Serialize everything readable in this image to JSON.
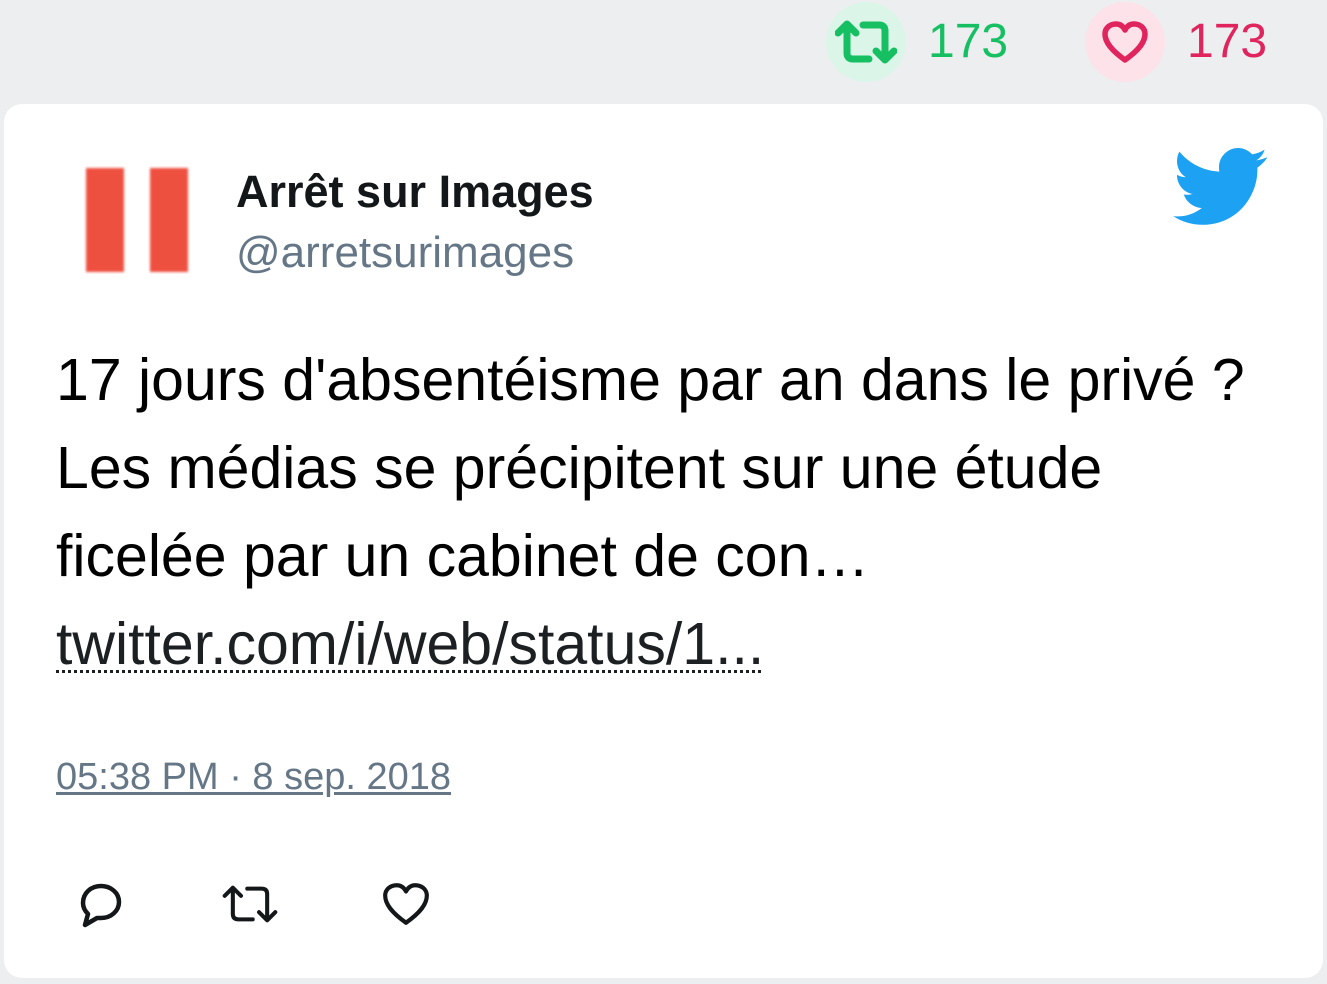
{
  "header_stats": {
    "retweets": {
      "icon": "retweet-icon",
      "count": "173",
      "color": "#17bf63"
    },
    "likes": {
      "icon": "heart-icon",
      "count": "173",
      "color": "#e0245e"
    }
  },
  "tweet": {
    "author_name": "Arrêt sur Images",
    "author_handle": "@arretsurimages",
    "avatar_icon": "pause-logo",
    "brand_icon": "twitter-bird-icon",
    "text": "17 jours d'absentéisme par an dans le privé ? Les médias se précipitent sur une étude ficelée par un cabinet de con… ",
    "link_text": "twitter.com/i/web/status/1...",
    "timestamp": "05:38 PM · 8 sep. 2018"
  },
  "actions": [
    {
      "icon": "reply-icon"
    },
    {
      "icon": "retweet-icon"
    },
    {
      "icon": "heart-icon"
    }
  ],
  "colors": {
    "background": "#eceef0",
    "card": "#ffffff",
    "twitter_blue": "#1da1f2",
    "muted": "#657786",
    "logo_red": "#ee5040"
  }
}
